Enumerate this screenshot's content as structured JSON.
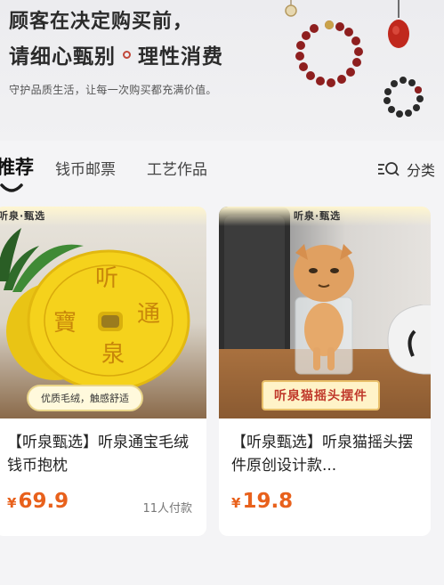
{
  "banner": {
    "line1": "顾客在决定购买前，",
    "line2_a": "请细心甄别",
    "line2_b": "理性消费",
    "subtitle": "守护品质生活，让每一次购买都充满价值。"
  },
  "tabs": {
    "items": [
      "推荐",
      "钱币邮票",
      "工艺作品"
    ],
    "active_index": 0,
    "category_label": "分类",
    "category_icon": "list-search-icon"
  },
  "products": [
    {
      "brand_tag": "听泉·甄选",
      "image_badge": "优质毛绒，触感舒适",
      "image_chars": [
        "听",
        "寶",
        "通",
        "泉"
      ],
      "title": "【听泉甄选】听泉通宝毛绒钱币抱枕",
      "currency": "¥",
      "price": "69.9",
      "paid_count": "11人付款"
    },
    {
      "brand_tag": "听泉·甄选",
      "image_badge": "听泉猫摇头摆件",
      "title": "【听泉甄选】听泉猫摇头摆件原创设计款...",
      "currency": "¥",
      "price": "19.8"
    }
  ],
  "colors": {
    "price": "#e8611c",
    "accent_green": "#2e7d32",
    "bead_red": "#8e1f1f",
    "pillow_yellow": "#f5d21c"
  }
}
